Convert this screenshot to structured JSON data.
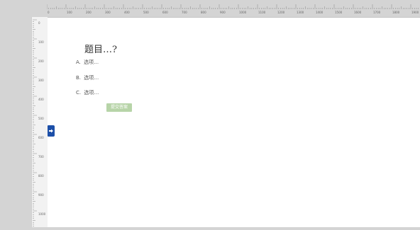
{
  "question": {
    "title": "题目…?",
    "options": [
      {
        "label": "A.",
        "text": "选项…"
      },
      {
        "label": "B.",
        "text": "选项…"
      },
      {
        "label": "C.",
        "text": "选项…"
      }
    ],
    "submit_label": "提交答案"
  },
  "ruler": {
    "top_ticks": [
      "0",
      "100",
      "200",
      "300",
      "400",
      "500",
      "600",
      "700",
      "800",
      "900",
      "1000",
      "1100",
      "1200",
      "1300",
      "1400",
      "1500",
      "1600",
      "1700",
      "1800",
      "1900"
    ],
    "left_ticks": [
      "0",
      "100",
      "200",
      "300",
      "400",
      "500",
      "600",
      "700",
      "800",
      "900",
      "1000"
    ]
  },
  "icons": {
    "handle": "arrow-right-icon"
  },
  "colors": {
    "handle": "#1c4fa8",
    "submit_bg": "#b7d4a8"
  }
}
